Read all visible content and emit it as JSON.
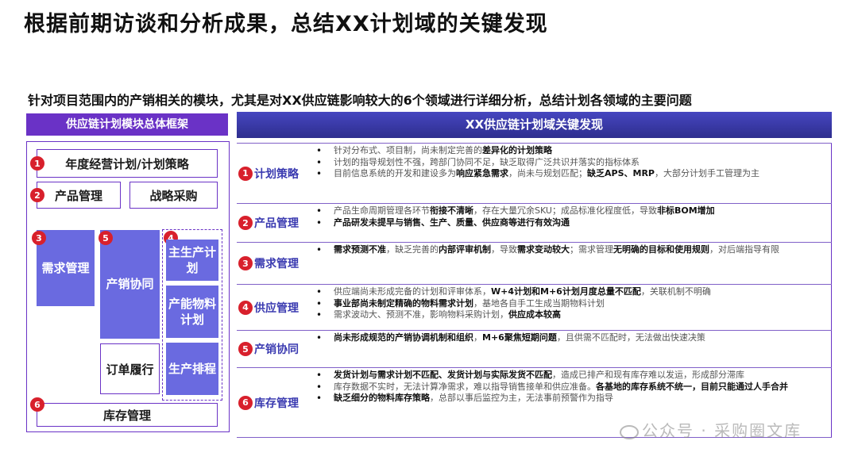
{
  "title": "根据前期访谈和分析成果，总结XX计划域的关键发现",
  "subtitle": "针对项目范围内的产销相关的模块，尤其是对XX供应链影响较大的6个领域进行详细分析，总结计划各领域的主要问题",
  "left_header": "供应链计划模块总体框架",
  "right_header": "XX供应链计划域关键发现",
  "framework": {
    "annual_plan": "年度经营计划/计划策略",
    "product_mgmt": "产品管理",
    "strategic_procurement": "战略采购",
    "demand_mgmt": "需求管理",
    "sop": "产销协同",
    "master_production": "主生产计划",
    "capacity_material": "产能物料计划",
    "production_scheduling": "生产排程",
    "order_fulfillment": "订单履行",
    "inventory_mgmt": "库存管理"
  },
  "markers": [
    "1",
    "2",
    "3",
    "4",
    "5",
    "6"
  ],
  "findings": [
    {
      "num": "1",
      "label": "计划策略",
      "items": [
        [
          {
            "t": "针对分布式、项目制，尚未制定完善的"
          },
          {
            "t": "差异化的计划策略",
            "b": true
          }
        ],
        [
          {
            "t": "计划的指导规划性不强，跨部门协同不足，缺乏取得广泛共识并落实的指标体系"
          }
        ],
        [
          {
            "t": "目前信息系统的开发和建设多为"
          },
          {
            "t": "响应紧急需求",
            "b": true
          },
          {
            "t": "，尚未与规划匹配；"
          },
          {
            "t": "缺乏APS、MRP",
            "b": true
          },
          {
            "t": "，大部分计划手工管理为主"
          }
        ]
      ]
    },
    {
      "num": "2",
      "label": "产品管理",
      "items": [
        [
          {
            "t": "产品生命周期管理各环节"
          },
          {
            "t": "衔接不清晰",
            "b": true
          },
          {
            "t": "，存在大量冗余SKU；成品标准化程度低，导致"
          },
          {
            "t": "非标BOM增加",
            "b": true
          }
        ],
        [
          {
            "t": "产品研发未提早与销售、生产、质量、供应商等进行",
            "b": true
          },
          {
            "t": "有效沟通",
            "b": true
          }
        ]
      ]
    },
    {
      "num": "3",
      "label": "需求管理",
      "items": [
        [
          {
            "t": "需求预测不准",
            "b": true
          },
          {
            "t": "，缺乏完善的"
          },
          {
            "t": "内部评审机制",
            "b": true
          },
          {
            "t": "，导致"
          },
          {
            "t": "需求变动较大",
            "b": true
          },
          {
            "t": "；需求管理"
          },
          {
            "t": "无明确的目标和使用规则",
            "b": true
          },
          {
            "t": "，对后端指导有限"
          }
        ]
      ]
    },
    {
      "num": "4",
      "label": "供应管理",
      "items": [
        [
          {
            "t": "供应端尚未形成完备的计划和评审体系，"
          },
          {
            "t": "W+4计划和M+6计划月度总量不匹配",
            "b": true
          },
          {
            "t": "，关联机制不明确"
          }
        ],
        [
          {
            "t": "事业部尚未制定精确的物料需求计划",
            "b": true
          },
          {
            "t": "，基地各自手工生成当期物料计划"
          }
        ],
        [
          {
            "t": "需求波动大、预测不准，影响物料采购计划，"
          },
          {
            "t": "供应成本较高",
            "b": true
          }
        ]
      ]
    },
    {
      "num": "5",
      "label": "产销协同",
      "items": [
        [
          {
            "t": "尚未形成规范的产销协调机制和组织",
            "b": true
          },
          {
            "t": "，"
          },
          {
            "t": "M+6聚焦短期问题",
            "b": true
          },
          {
            "t": "，且供需不匹配时，无法做出快速决策"
          }
        ]
      ]
    },
    {
      "num": "6",
      "label": "库存管理",
      "items": [
        [
          {
            "t": "发货计划与需求计划不匹配、发货计划与实际发货不匹配",
            "b": true
          },
          {
            "t": "，造成已排产和现有库存难以发运，形成部分滞库"
          }
        ],
        [
          {
            "t": "库存数据不实时，无法计算净需求，难以指导销售接单和供应准备。"
          },
          {
            "t": "各基地的库存系统不统一，目前只能通过人手合并",
            "b": true
          }
        ],
        [
          {
            "t": "缺乏细分的物料库存策略",
            "b": true
          },
          {
            "t": "，总部以事后监控为主，无法事前预警作为指导"
          }
        ]
      ]
    }
  ],
  "watermark": "公众号 · 采购圈文库"
}
